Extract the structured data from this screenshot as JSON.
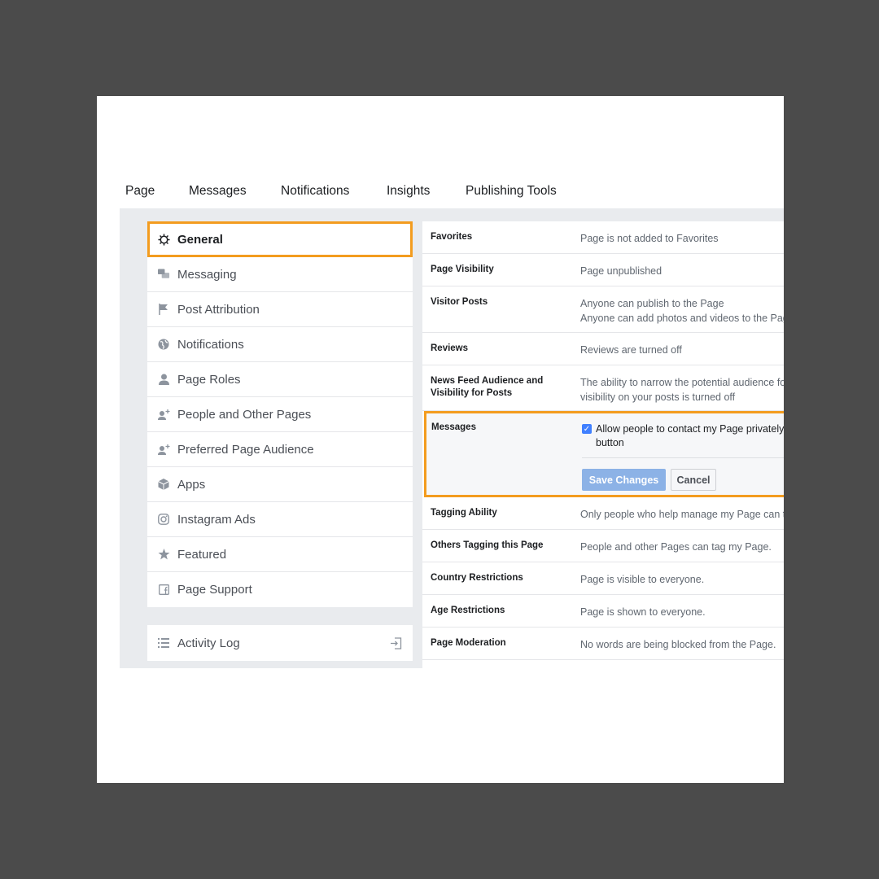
{
  "nav": {
    "items": [
      "Page",
      "Messages",
      "Notifications",
      "Insights",
      "Publishing Tools"
    ]
  },
  "sidebar": {
    "items": [
      {
        "label": "General",
        "icon": "gear-icon"
      },
      {
        "label": "Messaging",
        "icon": "chat-bubbles-icon"
      },
      {
        "label": "Post Attribution",
        "icon": "flag-icon"
      },
      {
        "label": "Notifications",
        "icon": "globe-icon"
      },
      {
        "label": "Page Roles",
        "icon": "person-icon"
      },
      {
        "label": "People and Other Pages",
        "icon": "person-plus-icon"
      },
      {
        "label": "Preferred Page Audience",
        "icon": "person-plus-icon"
      },
      {
        "label": "Apps",
        "icon": "cube-icon"
      },
      {
        "label": "Instagram Ads",
        "icon": "instagram-icon"
      },
      {
        "label": "Featured",
        "icon": "star-icon"
      },
      {
        "label": "Page Support",
        "icon": "facebook-icon"
      }
    ],
    "activity_log": "Activity Log"
  },
  "settings": {
    "rows": [
      {
        "label": "Favorites",
        "value": "Page is not added to Favorites"
      },
      {
        "label": "Page Visibility",
        "value": "Page unpublished"
      },
      {
        "label": "Visitor Posts",
        "value": "Anyone can publish to the Page",
        "value2": "Anyone can add photos and videos to the Page"
      },
      {
        "label": "Reviews",
        "value": "Reviews are turned off"
      },
      {
        "label": "News Feed Audience and Visibility for Posts",
        "value": "The ability to narrow the potential audience for News Feed and limit the",
        "value2": "visibility on your posts is turned off"
      }
    ],
    "messages": {
      "label": "Messages",
      "checkbox_text": "Allow people to contact my Page privately by showing the Message",
      "checkbox_text2": "button",
      "save_label": "Save Changes",
      "cancel_label": "Cancel"
    },
    "rows_after": [
      {
        "label": "Tagging Ability",
        "value": "Only people who help manage my Page can tag photos posted on it."
      },
      {
        "label": "Others Tagging this Page",
        "value": "People and other Pages can tag my Page."
      },
      {
        "label": "Country Restrictions",
        "value": "Page is visible to everyone."
      },
      {
        "label": "Age Restrictions",
        "value": "Page is shown to everyone."
      },
      {
        "label": "Page Moderation",
        "value": "No words are being blocked from the Page."
      }
    ]
  },
  "colors": {
    "highlight": "#f39c1f",
    "save_button": "#8cb2e6",
    "checkbox": "#4080ff"
  }
}
